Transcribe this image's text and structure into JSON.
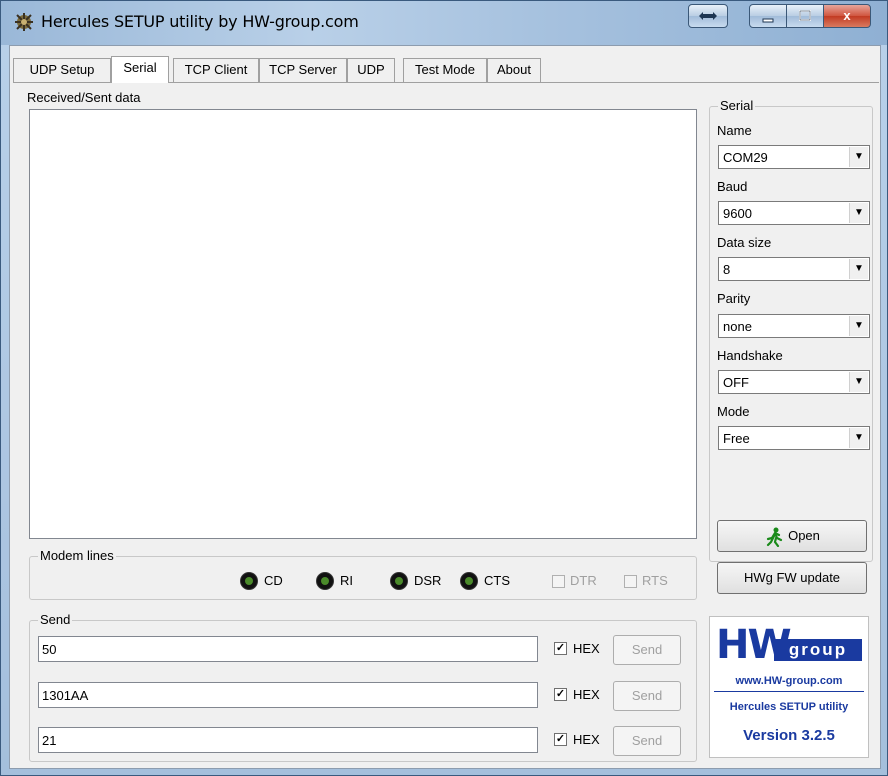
{
  "window": {
    "title": "Hercules SETUP utility by HW-group.com",
    "close_glyph": "x"
  },
  "tabs": [
    {
      "label": "UDP Setup"
    },
    {
      "label": "Serial",
      "active": true
    },
    {
      "label": "TCP Client"
    },
    {
      "label": "TCP Server"
    },
    {
      "label": "UDP"
    },
    {
      "label": "Test Mode"
    },
    {
      "label": "About"
    }
  ],
  "received": {
    "label": "Received/Sent data",
    "content": ""
  },
  "serial": {
    "group_label": "Serial",
    "name_label": "Name",
    "name_value": "COM29",
    "baud_label": "Baud",
    "baud_value": "9600",
    "datasize_label": "Data size",
    "datasize_value": "8",
    "parity_label": "Parity",
    "parity_value": "none",
    "handshake_label": "Handshake",
    "handshake_value": "OFF",
    "mode_label": "Mode",
    "mode_value": "Free",
    "open_label": "Open",
    "fw_update_label": "HWg FW update"
  },
  "modem": {
    "group_label": "Modem lines",
    "cd": "CD",
    "ri": "RI",
    "dsr": "DSR",
    "cts": "CTS",
    "dtr": "DTR",
    "rts": "RTS"
  },
  "send": {
    "group_label": "Send",
    "hex_label": "HEX",
    "button_label": "Send",
    "rows": [
      {
        "value": "50",
        "hex_checked": true
      },
      {
        "value": "1301AA",
        "hex_checked": true
      },
      {
        "value": "21",
        "hex_checked": true
      }
    ]
  },
  "logo": {
    "brand_hw": "HW",
    "brand_group": "group",
    "url": "www.HW-group.com",
    "product": "Hercules SETUP utility",
    "version": "Version  3.2.5"
  },
  "colors": {
    "led_on": "#4a8a2a",
    "logo_blue": "#1a3aa0"
  }
}
